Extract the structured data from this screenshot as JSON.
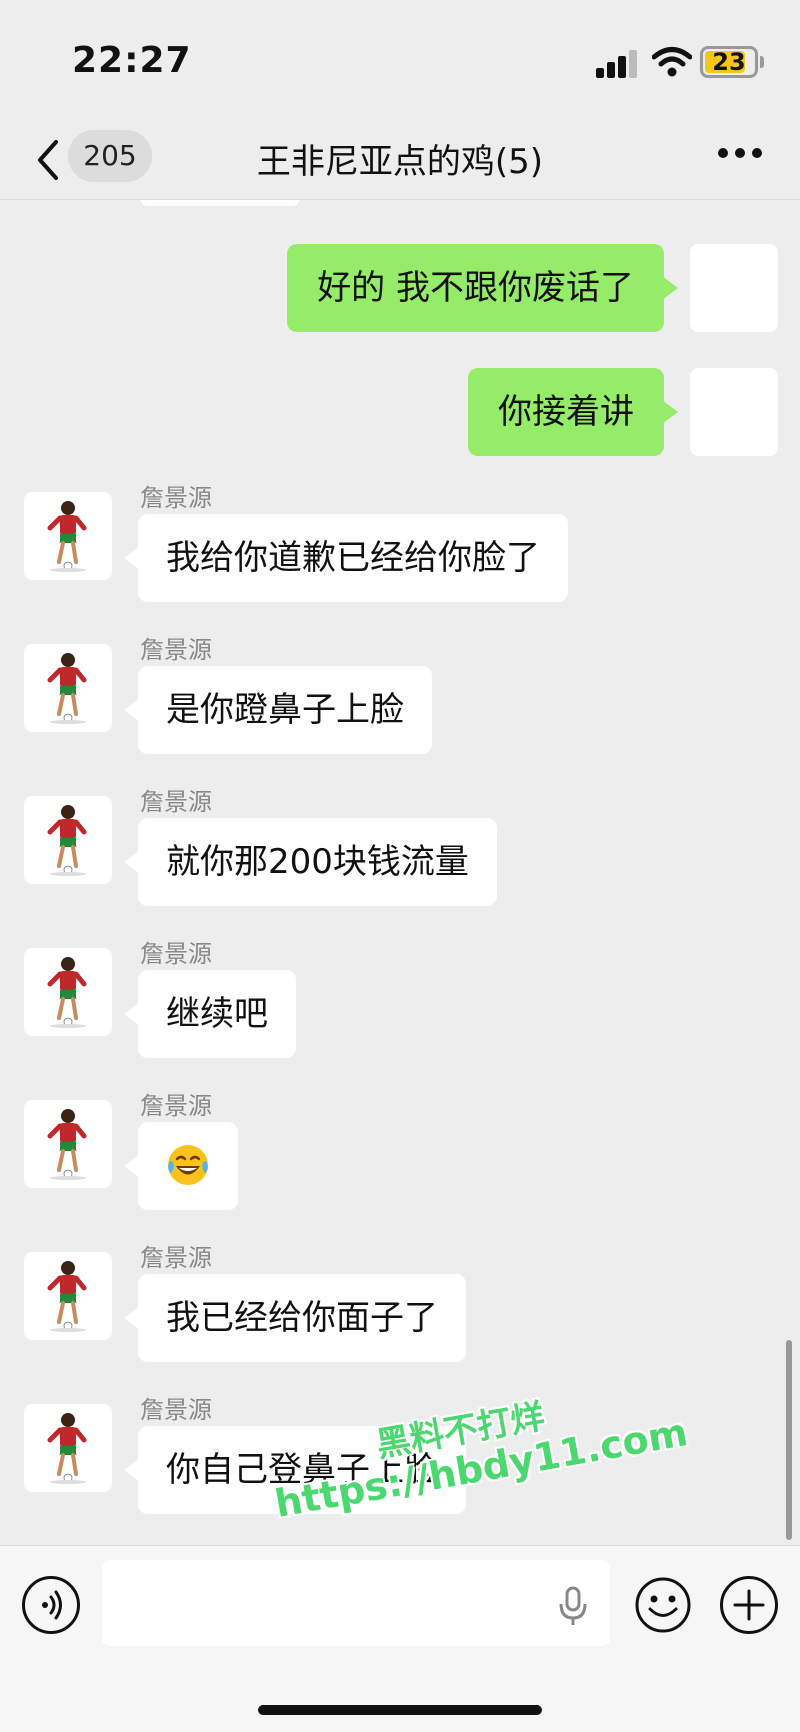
{
  "status_bar": {
    "time": "22:27",
    "battery": "23",
    "battery_color": "#f5c518"
  },
  "nav": {
    "back_count": "205",
    "title": "王非尼亚点的鸡(5)"
  },
  "colors": {
    "bubble_green": "#95ec69",
    "bubble_white": "#ffffff",
    "background": "#ededed"
  },
  "messages": {
    "right": [
      {
        "text": "好的 我不跟你废话了"
      },
      {
        "text": "你接着讲"
      }
    ],
    "left": [
      {
        "sender": "詹景源",
        "text": "我给你道歉已经给你脸了"
      },
      {
        "sender": "詹景源",
        "text": "是你蹬鼻子上脸"
      },
      {
        "sender": "詹景源",
        "text": "就你那200块钱流量"
      },
      {
        "sender": "詹景源",
        "text": "继续吧"
      },
      {
        "sender": "詹景源",
        "emoji": "laughing-with-tears-emoji"
      },
      {
        "sender": "詹景源",
        "text": "我已经给你面子了"
      },
      {
        "sender": "詹景源",
        "text": "你自己登鼻子上脸"
      }
    ]
  },
  "watermark": {
    "line1": "黑料不打烊",
    "line2": "https://hbdy11.com"
  },
  "input": {
    "placeholder": "",
    "value": ""
  }
}
